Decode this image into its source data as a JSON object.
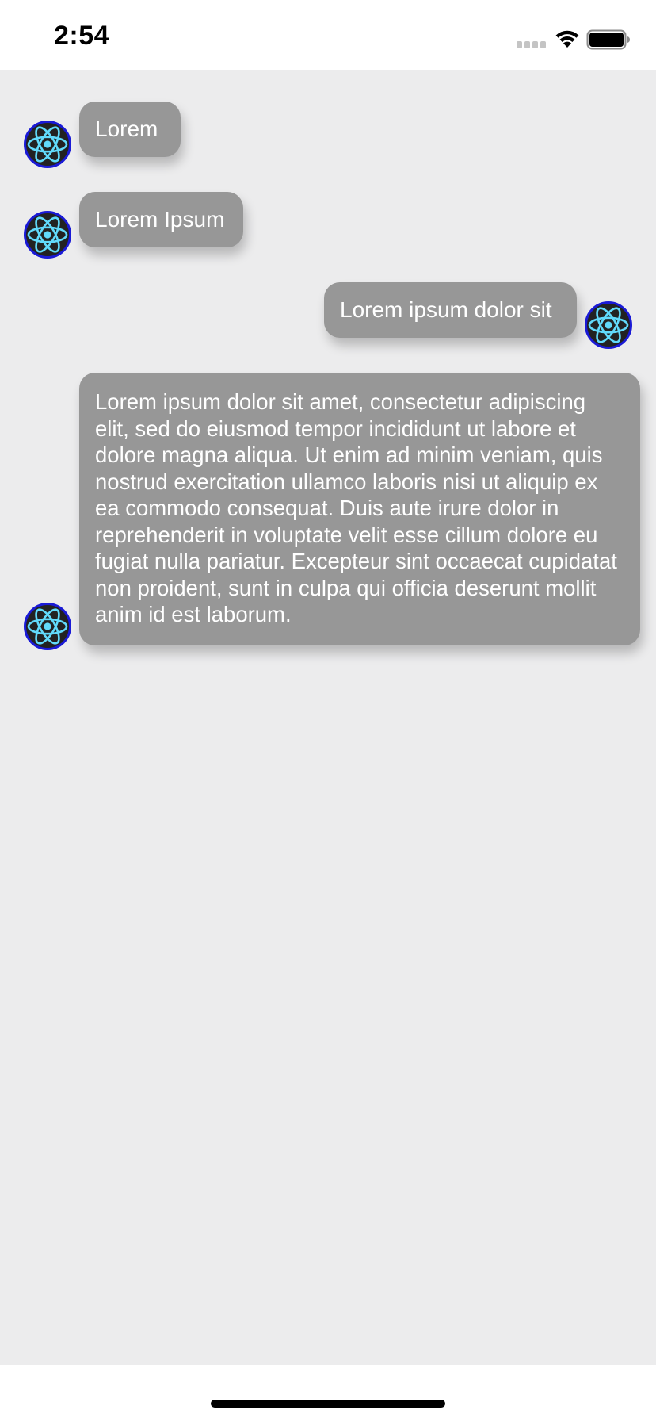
{
  "status_bar": {
    "time": "2:54",
    "signal_icon": "cellular-signal-icon",
    "wifi_icon": "wifi-icon",
    "battery_icon": "battery-icon"
  },
  "colors": {
    "background": "#ececed",
    "bubble": "#979797",
    "bubble_text": "#ffffff",
    "avatar_ring": "#1a1ad6",
    "avatar_fill": "#222222",
    "atom": "#61dafb"
  },
  "messages": [
    {
      "side": "left",
      "avatar_icon": "react-atom-icon",
      "text": "Lorem"
    },
    {
      "side": "left",
      "avatar_icon": "react-atom-icon",
      "text": "Lorem Ipsum"
    },
    {
      "side": "right",
      "avatar_icon": "react-atom-icon",
      "text": "Lorem ipsum dolor sit"
    },
    {
      "side": "left",
      "avatar_icon": "react-atom-icon",
      "text": "Lorem ipsum dolor sit amet, consectetur adipiscing elit, sed do eiusmod tempor incididunt ut labore et dolore magna aliqua. Ut enim ad minim veniam, quis nostrud exercitation ullamco laboris nisi ut aliquip ex ea commodo consequat. Duis aute irure dolor in reprehenderit in voluptate velit esse cillum dolore eu fugiat nulla pariatur. Excepteur sint occaecat cupidatat non proident, sunt in culpa qui officia deserunt mollit anim id est laborum."
    }
  ]
}
